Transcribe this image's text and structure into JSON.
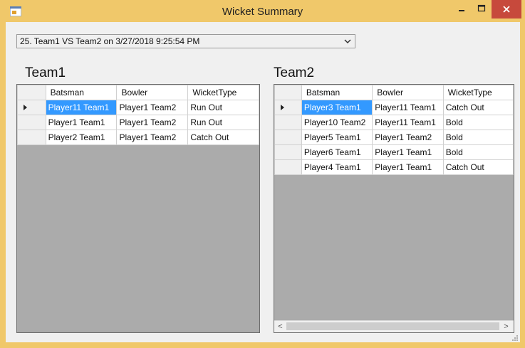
{
  "window": {
    "title": "Wicket Summary"
  },
  "match_selector": {
    "value": "25. Team1 VS Team2 on 3/27/2018 9:25:54 PM"
  },
  "columns": [
    "Batsman",
    "Bowler",
    "WicketType"
  ],
  "team1": {
    "label": "Team1",
    "rows": [
      [
        "Player11 Team1",
        "Player1 Team2",
        "Run Out"
      ],
      [
        "Player1 Team1",
        "Player1 Team2",
        "Run Out"
      ],
      [
        "Player2 Team1",
        "Player1 Team2",
        "Catch Out"
      ]
    ]
  },
  "team2": {
    "label": "Team2",
    "rows": [
      [
        "Player3 Team1",
        "Player11 Team1",
        "Catch Out"
      ],
      [
        "Player10 Team2",
        "Player11 Team1",
        "Bold"
      ],
      [
        "Player5 Team1",
        "Player1 Team2",
        "Bold"
      ],
      [
        "Player6 Team1",
        "Player1 Team1",
        "Bold"
      ],
      [
        "Player4 Team1",
        "Player1 Team1",
        "Catch Out"
      ]
    ]
  },
  "colors": {
    "selection": "#3399ff",
    "frame": "#f0c86a",
    "close": "#c7493c",
    "grid_background": "#ababab"
  },
  "icons": {
    "minimize": "minimize-icon",
    "maximize": "maximize-icon",
    "close": "close-icon",
    "dropdown": "chevron-down-icon",
    "current_row": "row-pointer-icon"
  }
}
